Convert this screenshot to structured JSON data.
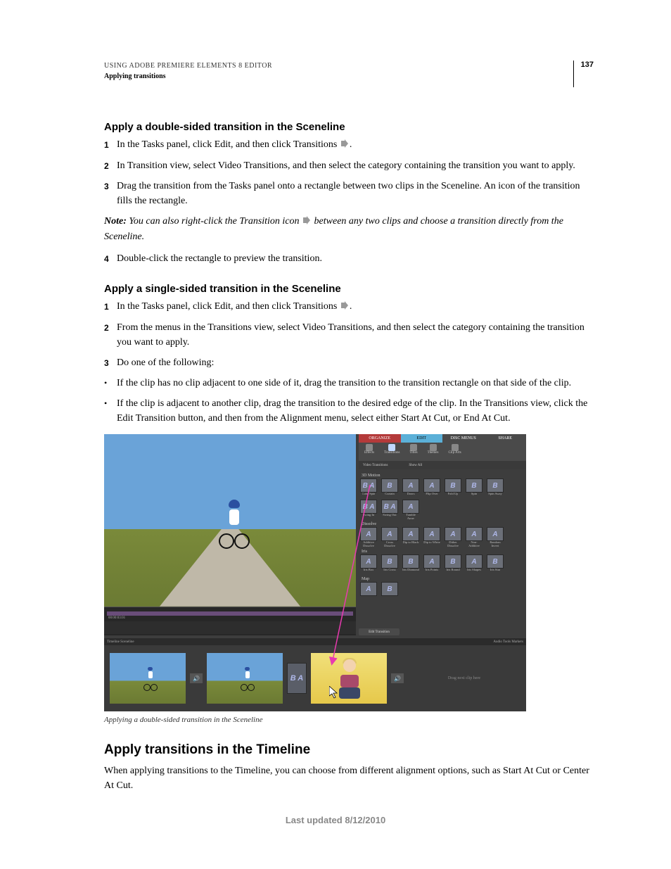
{
  "header": {
    "title": "USING ADOBE PREMIERE ELEMENTS 8 EDITOR",
    "section": "Applying transitions",
    "page_number": "137"
  },
  "sec1": {
    "heading": "Apply a double-sided transition in the Sceneline",
    "step1": "In the Tasks panel, click Edit, and then click Transitions ",
    "step1b": ".",
    "step2": "In Transition view, select Video Transitions, and then select the category containing the transition you want to apply.",
    "step3": "Drag the transition from the Tasks panel onto a rectangle between two clips in the Sceneline. An icon of the transition fills the rectangle.",
    "note_label": "Note: ",
    "note_a": "You can also right-click the Transition icon ",
    "note_b": " between any two clips and choose a transition directly from the Sceneline.",
    "step4": "Double-click the rectangle to preview the transition."
  },
  "sec2": {
    "heading": "Apply a single-sided transition in the Sceneline",
    "step1": "In the Tasks panel, click Edit, and then click Transitions ",
    "step1b": ".",
    "step2": "From the menus in the Transitions view, select Video Transitions, and then select the category containing the transition you want to apply.",
    "step3": "Do one of the following:",
    "b1": "If the clip has no clip adjacent to one side of it, drag the transition to the transition rectangle on that side of the clip.",
    "b2": "If the clip is adjacent to another clip, drag the transition to the desired edge of the clip. In the Transitions view, click the Edit Transition button, and then from the Alignment menu, select either Start At Cut, or End At Cut."
  },
  "figure": {
    "tabs": {
      "organize": "ORGANIZE",
      "edit": "EDIT",
      "disc_menus": "DISC MENUS",
      "share": "SHARE"
    },
    "toolbar": {
      "effects": "Effects",
      "transitions": "Transitions",
      "titles": "Titles",
      "themes": "Themes",
      "clip_arts": "Clip Arts"
    },
    "filter": {
      "video_transitions": "Video Transitions",
      "show_all": "Show All"
    },
    "sections": {
      "s3d": "3D Motion",
      "s3d_items": [
        "Cube Spin",
        "Curtain",
        "Doors",
        "Flip Over",
        "Fold Up",
        "Spin",
        "Spin Away"
      ],
      "door": "",
      "door_items": [
        "Swing In",
        "Swing Out",
        "Tumble Away"
      ],
      "dissolve": "Dissolve",
      "dissolve_items": [
        "Additive Dissolve",
        "Cross Dissolve",
        "Dip to Black",
        "Dip to White",
        "Dither Dissolve",
        "Non-Additive Dissolve",
        "Random Invert"
      ],
      "iris": "Iris",
      "iris_items": [
        "Iris Box",
        "Iris Cross",
        "Iris Diamond",
        "Iris Points",
        "Iris Round",
        "Iris Shapes",
        "Iris Star"
      ],
      "map": "Map",
      "map_items": [
        "",
        ""
      ]
    },
    "edit_transition_btn": "Edit Transition",
    "sceneline_left": "Timeline   Sceneline",
    "sceneline_right": "Audio Tools      Markers",
    "drop_label": "Drag next clip here",
    "timecode": "00:00:03:01",
    "caption": "Applying a double-sided transition in the Sceneline"
  },
  "sec3": {
    "heading": "Apply transitions in the Timeline",
    "p": "When applying transitions to the Timeline, you can choose from different alignment options, such as Start At Cut or Center At Cut."
  },
  "footer": "Last updated 8/12/2010"
}
